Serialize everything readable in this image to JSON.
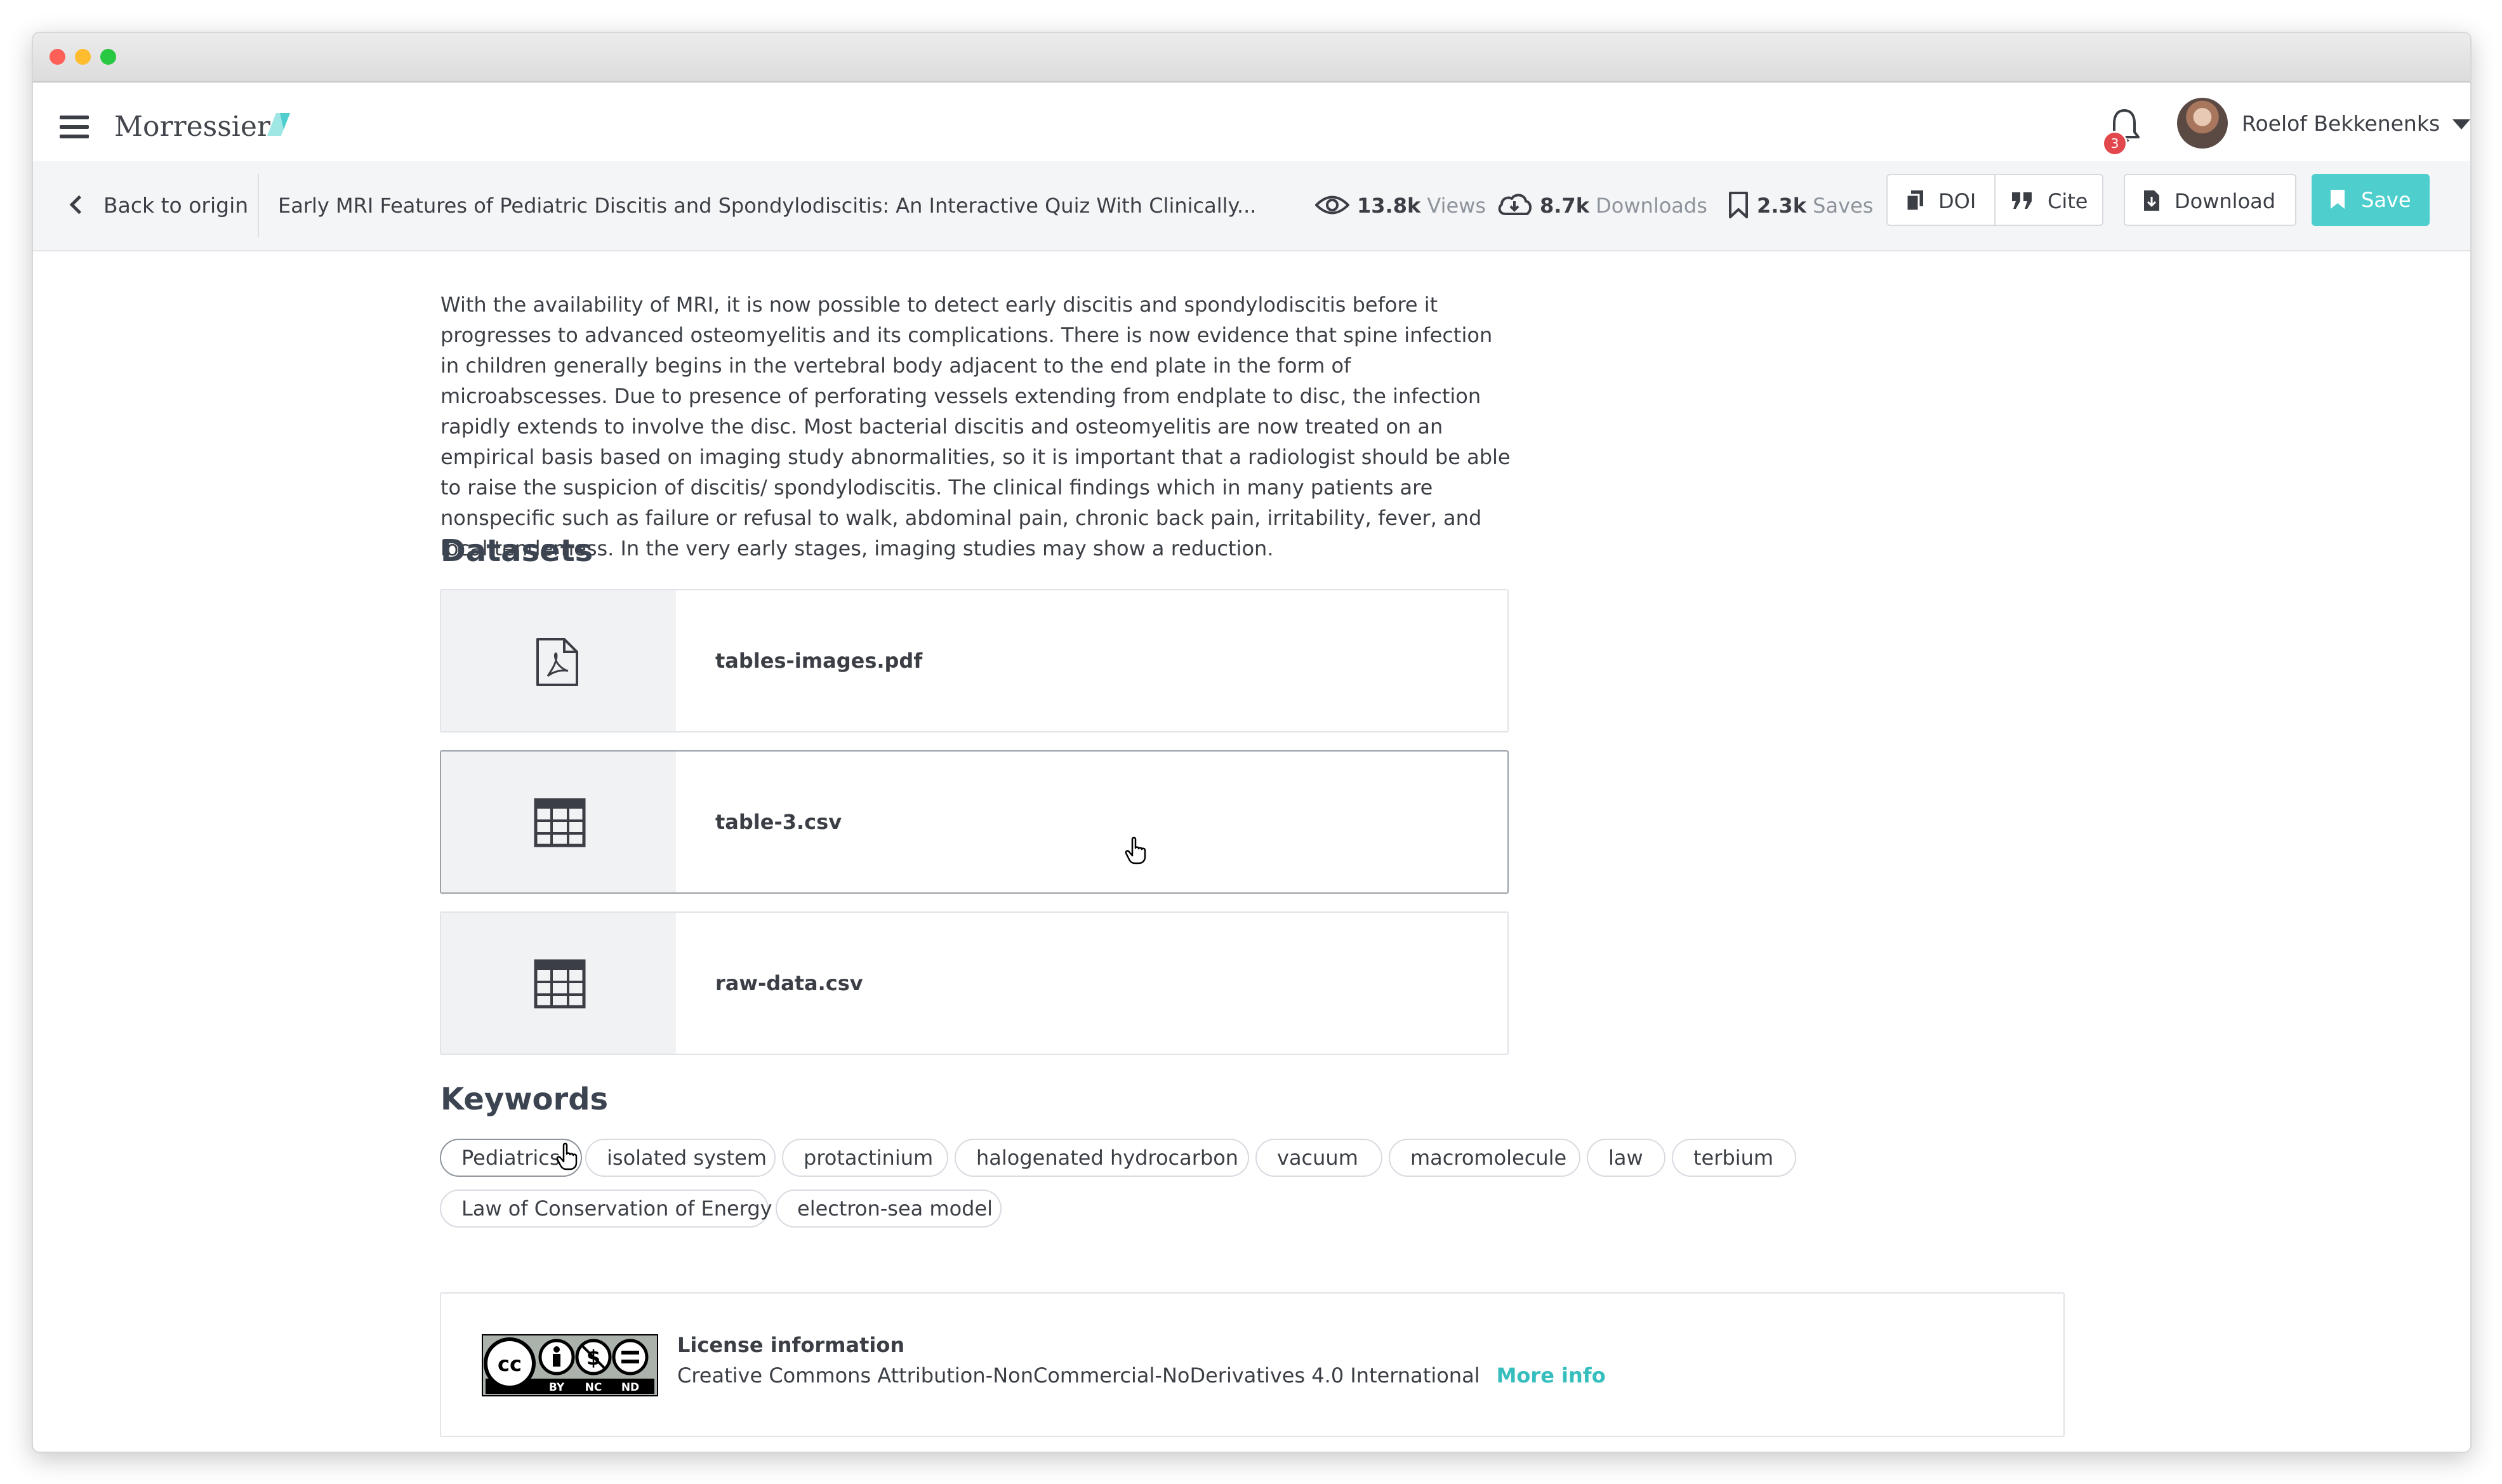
{
  "app": {
    "brand": "Morressier"
  },
  "notifications": {
    "count": "3"
  },
  "user": {
    "name": "Roelof Bekkenenks"
  },
  "subbar": {
    "back_label": "Back to origin",
    "paper_title": "Early MRI Features of Pediatric Discitis and Spondylodiscitis: An Interactive Quiz With Clinically...",
    "views_value": "13.8k",
    "views_label": "Views",
    "downloads_value": "8.7k",
    "downloads_label": "Downloads",
    "saves_value": "2.3k",
    "saves_label": "Saves",
    "doi_label": "DOI",
    "cite_label": "Cite",
    "download_label": "Download",
    "save_label": "Save"
  },
  "abstract": {
    "text": "With the availability of MRI, it is now possible to detect early discitis and spondylodiscitis before it progresses to advanced osteomyelitis and its complications. There is now evidence that spine infection in children generally begins in the vertebral body adjacent to the end plate in the form of microabscesses. Due to presence of perforating vessels extending from endplate to disc, the infection rapidly extends to involve the disc. Most bacterial discitis and osteomyelitis are now treated on an empirical basis based on imaging study abnormalities, so it is important that a radiologist should be able to raise the suspicion of discitis/ spondylodiscitis. The clinical findings which in many patients are nonspecific such as failure or refusal to walk, abdominal pain, chronic back pain, irritability, fever, and local tenderness. In the very early stages, imaging studies may show a reduction."
  },
  "datasets": {
    "title": "Datasets",
    "items": [
      {
        "name": "tables-images.pdf",
        "icon": "pdf-file-icon"
      },
      {
        "name": "table-3.csv",
        "icon": "table-icon"
      },
      {
        "name": "raw-data.csv",
        "icon": "table-icon"
      }
    ]
  },
  "keywords": {
    "title": "Keywords",
    "items": [
      "Pediatrics",
      "isolated system",
      "protactinium",
      "halogenated hydrocarbon",
      "vacuum",
      "macromolecule",
      "law",
      "terbium",
      "Law of Conservation of Energy",
      "electron-sea model"
    ]
  },
  "license": {
    "title": "License information",
    "text": "Creative Commons Attribution-NonCommercial-NoDerivatives 4.0 International",
    "link": "More info",
    "badge_labels": [
      "BY",
      "NC",
      "ND"
    ]
  },
  "colors": {
    "accent": "#4ecfce",
    "link": "#36bdbd",
    "badge": "#e2474c"
  }
}
